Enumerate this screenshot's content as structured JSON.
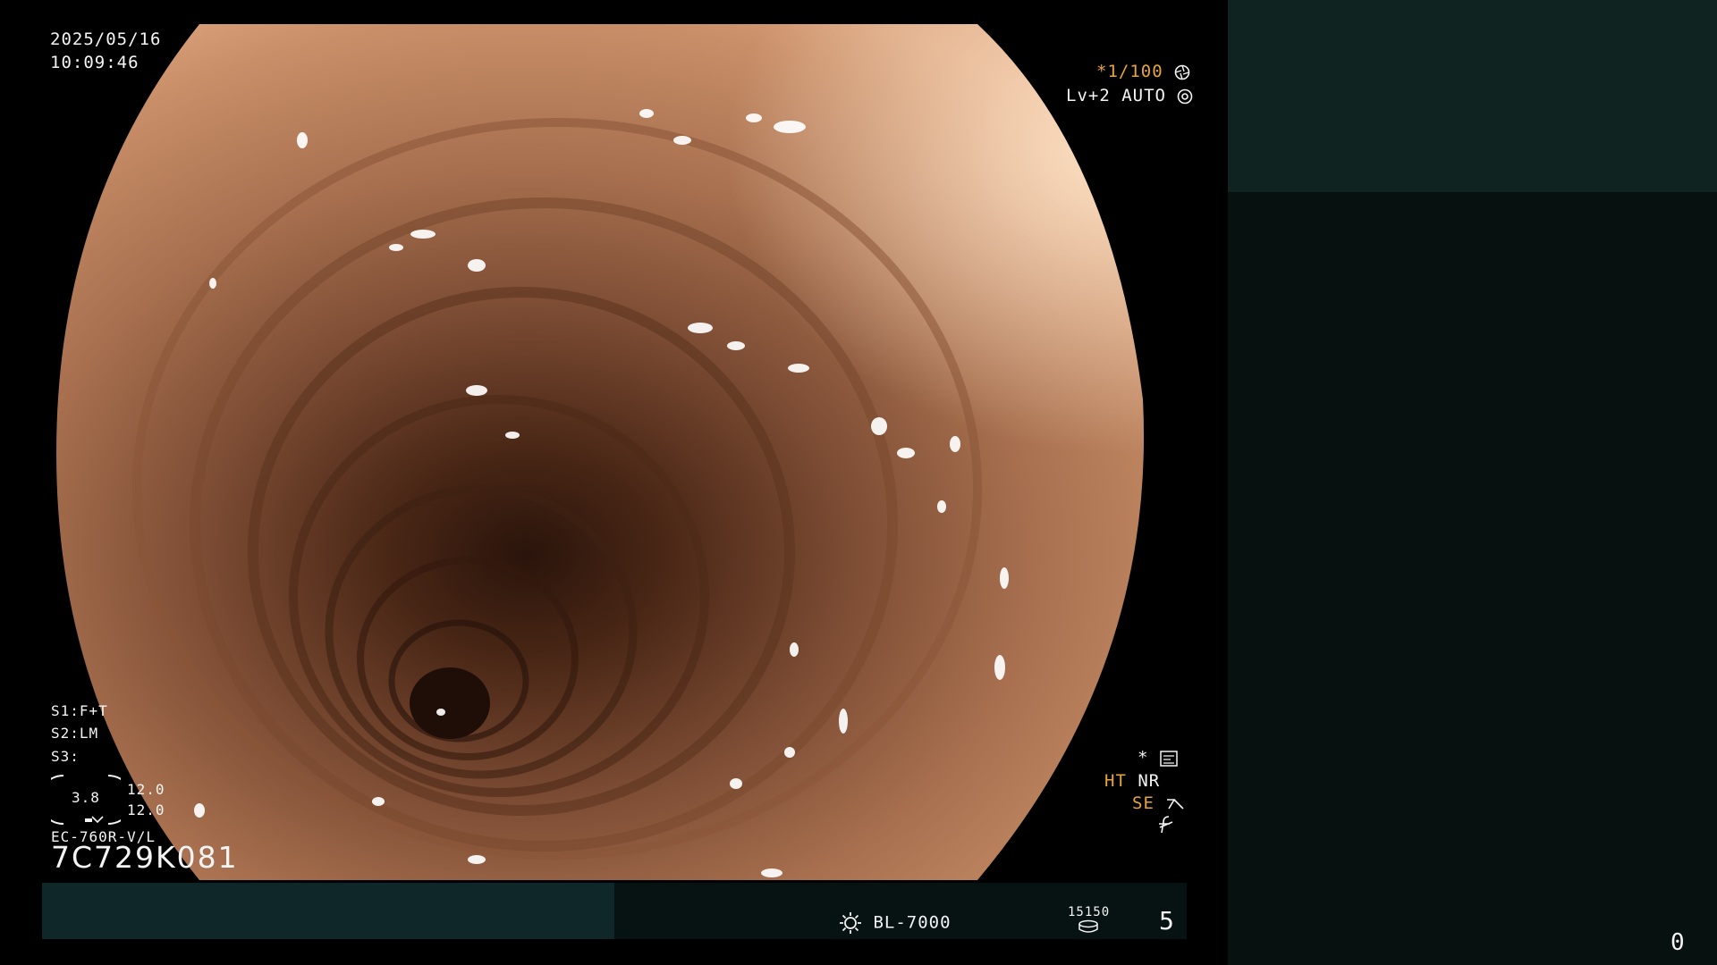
{
  "osd": {
    "date": "2025/05/16",
    "time": "10:09:46",
    "shutter": "*1/100",
    "level_auto": "Lv+2 AUTO",
    "s1": "S1:F+T",
    "s2": "S2:LM",
    "s3": "S3:",
    "gauge_value": "3.8",
    "gauge_right_top": "12.0",
    "gauge_right_bottom": "12.0",
    "scope_model": "EC-760R-V/L",
    "scope_serial": "7C729K081",
    "right_star": "*",
    "ht": "HT",
    "nr": "NR",
    "se": "SE",
    "light_source": "BL-7000",
    "counter_small": "15150",
    "counter_big": "5",
    "corner_number": "0"
  },
  "icons": {
    "shutter": "aperture-icon",
    "auto": "iris-icon",
    "image_mode": "image-mode-icon",
    "se": "enhance-icon",
    "f_mode": "f-mode-icon",
    "light": "lamp-icon",
    "counter": "disc-counter-icon"
  },
  "colors": {
    "amber": "#e6a53c",
    "panel_top": "#0f2421",
    "panel_bottom": "#061110",
    "bar_a": "#10272a",
    "bar_b": "#061312"
  }
}
